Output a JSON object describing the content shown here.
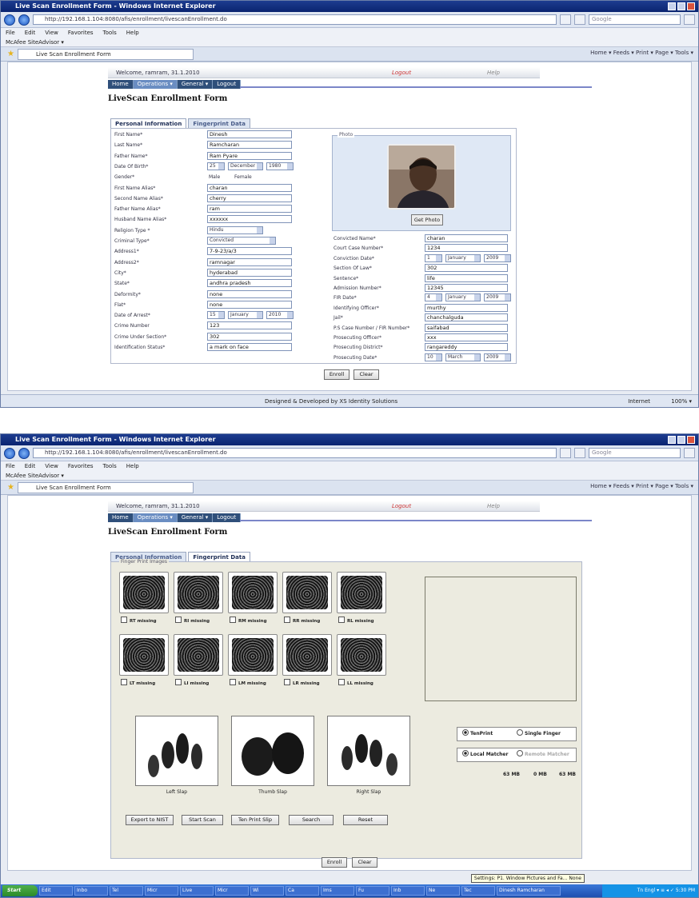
{
  "browser": {
    "window_title": "Live Scan Enrollment Form - Windows Internet Explorer",
    "url": "http://192.168.1.104:8080/afis/enrollment/livescanEnrollment.do",
    "search_placeholder": "Google",
    "menu": [
      "File",
      "Edit",
      "View",
      "Favorites",
      "Tools",
      "Help"
    ],
    "links_bar": "McAfee SiteAdvisor ▾",
    "tab_title": "Live Scan Enrollment Form",
    "command_bar": "Home ▾   Feeds ▾   Print ▾   Page ▾   Tools ▾",
    "status_zone": "Internet",
    "status_zoom": "100% ▾"
  },
  "app": {
    "welcome": "Welcome, ramram, 31.1.2010",
    "logo": "Logout",
    "logo2": "Help",
    "nav": [
      {
        "label": "Home"
      },
      {
        "label": "Operations ▾"
      },
      {
        "label": "General ▾"
      },
      {
        "label": "Logout"
      }
    ],
    "page_title": "LiveScan Enrollment Form",
    "tabs": {
      "personal": "Personal Information",
      "fingerprint": "Fingerprint Data"
    },
    "footer": "Designed & Developed by XS Identity Solutions",
    "buttons": {
      "enroll": "Enroll",
      "clear": "Clear"
    }
  },
  "personal": {
    "fields": [
      {
        "label": "First Name*",
        "value": "Dinesh"
      },
      {
        "label": "Last Name*",
        "value": "Ramcharan"
      },
      {
        "label": "Father Name*",
        "value": "Ram Pyare"
      },
      {
        "label": "Date Of Birth*",
        "day": "25",
        "month": "December",
        "year": "1980"
      },
      {
        "label": "Gender*",
        "male": "Male",
        "female": "Female"
      },
      {
        "label": "First Name Alias*",
        "value": "charan"
      },
      {
        "label": "Second Name Alias*",
        "value": "cherry"
      },
      {
        "label": "Father Name Alias*",
        "value": "ram"
      },
      {
        "label": "Husband Name Alias*",
        "value": "xxxxxx"
      },
      {
        "label": "Religion Type *",
        "value": "Hindu"
      },
      {
        "label": "Criminal Type*",
        "value": "Convicted"
      },
      {
        "label": "Address1*",
        "value": "7-9-23/a/3"
      },
      {
        "label": "Address2*",
        "value": "ramnagar"
      },
      {
        "label": "City*",
        "value": "hyderabad"
      },
      {
        "label": "State*",
        "value": "andhra pradesh"
      },
      {
        "label": "Deformity*",
        "value": "none"
      },
      {
        "label": "Flat*",
        "value": "none"
      },
      {
        "label": "Date of Arrest*",
        "day": "15",
        "month": "January",
        "year": "2010"
      },
      {
        "label": "Crime Number",
        "value": "123"
      },
      {
        "label": "Crime Under Section*",
        "value": "302"
      },
      {
        "label": "Identification Status*",
        "value": "a mark on face"
      }
    ],
    "photo_legend": "Photo",
    "get_photo": "Get Photo",
    "right_fields": [
      {
        "label": "Convicted Name*",
        "value": "charan"
      },
      {
        "label": "Court Case Number*",
        "value": "1234"
      },
      {
        "label": "Conviction Date*",
        "day": "1",
        "month": "January",
        "year": "2009"
      },
      {
        "label": "Section Of Law*",
        "value": "302"
      },
      {
        "label": "Sentence*",
        "value": "life"
      },
      {
        "label": "Admission Number*",
        "value": "12345"
      },
      {
        "label": "FIR Date*",
        "day": "4",
        "month": "January",
        "year": "2009"
      },
      {
        "label": "Identifying Officer*",
        "value": "murthy"
      },
      {
        "label": "Jail*",
        "value": "chanchalguda"
      },
      {
        "label": "P.S Case Number / FIR Number*",
        "value": "saifabad"
      },
      {
        "label": "Prosecuting Officer*",
        "value": "xxx"
      },
      {
        "label": "Prosecuting District*",
        "value": "rangareddy"
      },
      {
        "label": "Prosecuting Date*",
        "day": "10",
        "month": "March",
        "year": "2009"
      }
    ]
  },
  "fingerprint": {
    "legend": "Finger Print Images",
    "right_hand": [
      "RT missing",
      "RI missing",
      "RM missing",
      "RR missing",
      "RL missing"
    ],
    "left_hand": [
      "LT missing",
      "LI missing",
      "LM missing",
      "LR missing",
      "LL missing"
    ],
    "slaps": [
      "Left Slap",
      "Thumb Slap",
      "Right Slap"
    ],
    "mode": {
      "tenprint": "TenPrint",
      "single": "Single Finger"
    },
    "matcher": {
      "local": "Local Matcher",
      "remote": "Remote Matcher"
    },
    "sizes": [
      "63 MB",
      "0 MB",
      "63 MB"
    ],
    "actions": [
      "Export to NIST",
      "Start Scan",
      "Ten Print Slip",
      "Search",
      "Reset"
    ],
    "taskbar": {
      "start": "Start",
      "tasks": [
        "Edit",
        "Inbo",
        "Tel",
        "Micr",
        "Live",
        "Micr",
        "Wi",
        "Ca",
        "Ims",
        "Fu",
        "Inb",
        "Ne",
        "Tec",
        "Dinesh Ramcharan"
      ],
      "tooltip": "Settings: P1. Window Pictures and Fa... None",
      "tray": "Tn Engl  ▾  ≡  ◂  ✓  5:30 PM"
    }
  }
}
